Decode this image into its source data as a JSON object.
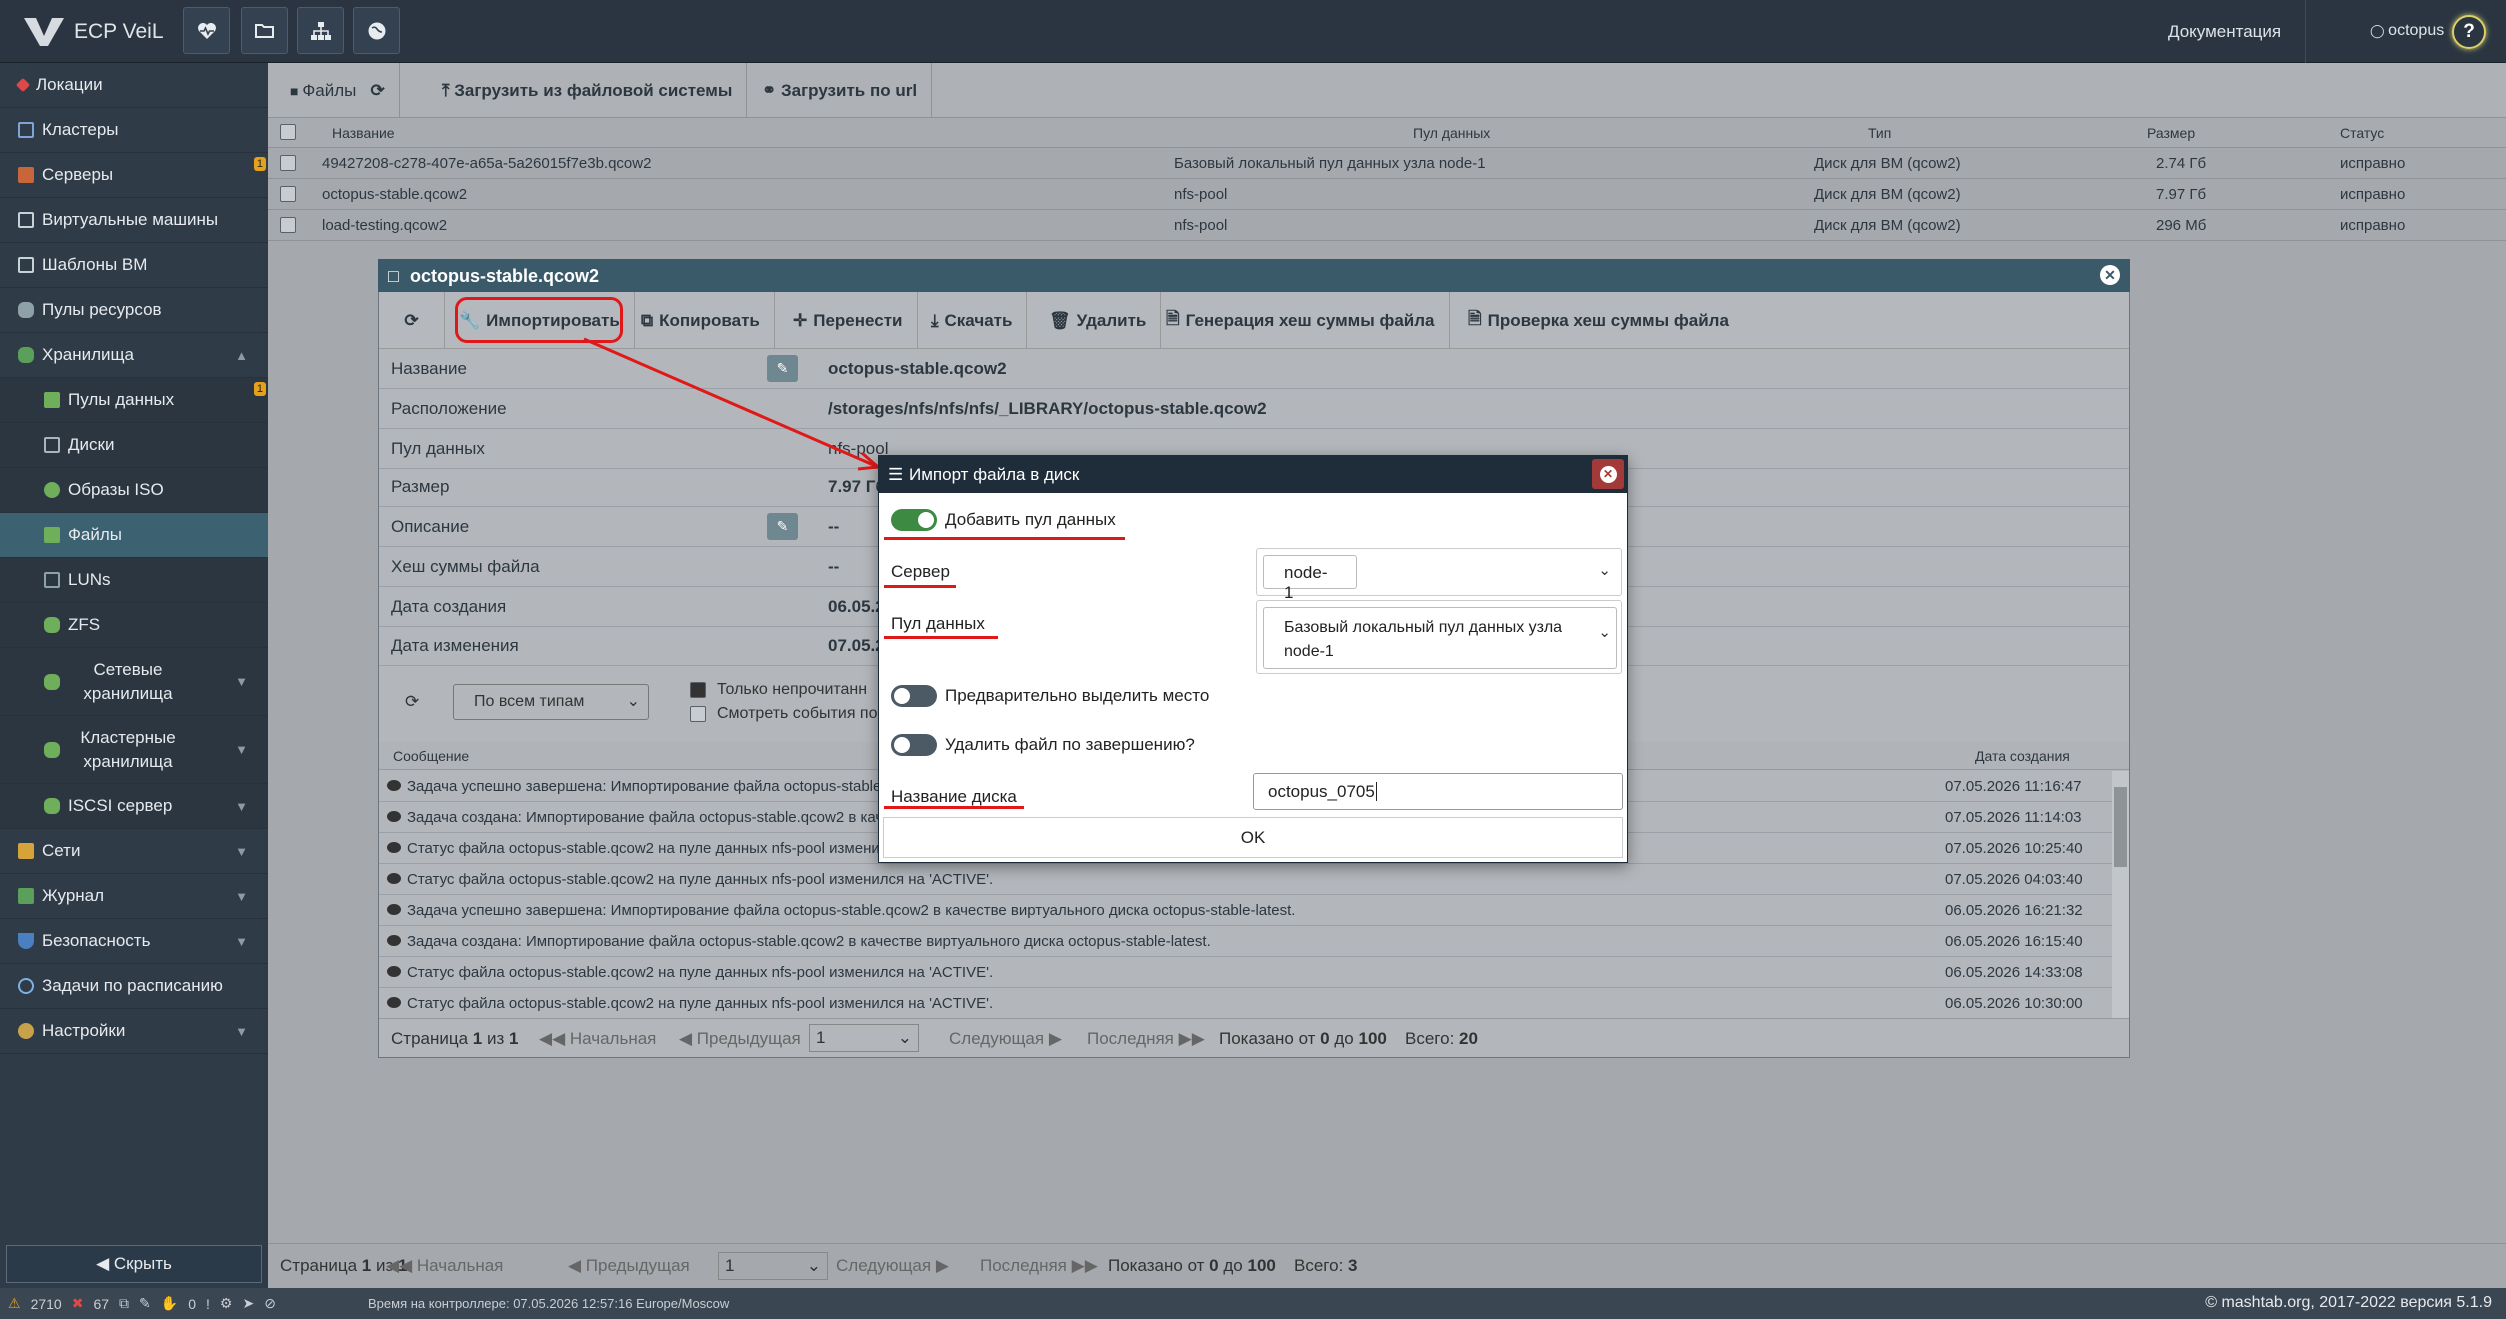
{
  "app": {
    "title": "ECP VeiL",
    "doc_link": "Документация",
    "user": "octopus",
    "help": "?"
  },
  "sidebar": {
    "items": [
      {
        "label": "Локации"
      },
      {
        "label": "Кластеры"
      },
      {
        "label": "Серверы",
        "badge": "1"
      },
      {
        "label": "Виртуальные машины"
      },
      {
        "label": "Шаблоны ВМ"
      },
      {
        "label": "Пулы ресурсов"
      },
      {
        "label": "Хранилища"
      },
      {
        "label": "Пулы данных",
        "badge": "1"
      },
      {
        "label": "Диски"
      },
      {
        "label": "Образы ISO"
      },
      {
        "label": "Файлы"
      },
      {
        "label": "LUNs"
      },
      {
        "label": "ZFS"
      },
      {
        "label": "Сетевые хранилища"
      },
      {
        "label": "Кластерные хранилища"
      },
      {
        "label": "ISCSI сервер"
      },
      {
        "label": "Сети"
      },
      {
        "label": "Журнал"
      },
      {
        "label": "Безопасность"
      },
      {
        "label": "Задачи по расписанию"
      },
      {
        "label": "Настройки"
      }
    ],
    "hide_label": "Скрыть"
  },
  "toolbar": {
    "files": "Файлы",
    "upload_fs": "Загрузить из файловой системы",
    "upload_url": "Загрузить по url"
  },
  "table": {
    "columns": [
      "Название",
      "Пул данных",
      "Тип",
      "Размер",
      "Статус"
    ],
    "rows": [
      {
        "name": "49427208-c278-407e-a65a-5a26015f7e3b.qcow2",
        "pool": "Базовый локальный пул данных узла node-1",
        "type": "Диск для ВМ (qcow2)",
        "size": "2.74 Гб",
        "status": "исправно"
      },
      {
        "name": "octopus-stable.qcow2",
        "pool": "nfs-pool",
        "type": "Диск для ВМ (qcow2)",
        "size": "7.97 Гб",
        "status": "исправно"
      },
      {
        "name": "load-testing.qcow2",
        "pool": "nfs-pool",
        "type": "Диск для ВМ (qcow2)",
        "size": "296 Мб",
        "status": "исправно"
      }
    ]
  },
  "footer": {
    "page": "Страница",
    "page_num": "1",
    "of": "из",
    "total_pages": "1",
    "first": "Начальная",
    "prev": "Предыдущая",
    "page_select": "1",
    "next": "Следующая",
    "last": "Последняя",
    "shown": "Показано от",
    "from": "0",
    "to_word": "до",
    "to": "100",
    "total_label": "Всего:",
    "total": "3"
  },
  "window": {
    "title": "octopus-stable.qcow2",
    "id_tag": "id",
    "actions": {
      "import": "Импортировать",
      "copy": "Копировать",
      "move": "Перенести",
      "download": "Скачать",
      "delete": "Удалить",
      "gen_hash": "Генерация хеш суммы файла",
      "check_hash": "Проверка хеш суммы файла"
    },
    "props": [
      {
        "key": "Название",
        "value": "octopus-stable.qcow2"
      },
      {
        "key": "Расположение",
        "value": "/storages/nfs/nfs/nfs/_LIBRARY/octopus-stable.qcow2"
      },
      {
        "key": "Пул данных",
        "value": "nfs-pool"
      },
      {
        "key": "Размер",
        "value": "7.97 Гб"
      },
      {
        "key": "Описание",
        "value": "--"
      },
      {
        "key": "Хеш суммы файла",
        "value": "--"
      },
      {
        "key": "Дата создания",
        "value": "06.05.2"
      },
      {
        "key": "Дата изменения",
        "value": "07.05.2"
      }
    ],
    "filter": {
      "type_select": "По всем типам",
      "unread_only": "Только непрочитанн",
      "view_events": "Смотреть события по"
    },
    "events_header": {
      "message": "Сообщение",
      "date": "Дата создания"
    },
    "events": [
      {
        "msg": "Задача успешно завершена: Импортирование файла octopus-stable",
        "date": "07.05.2026 11:16:47"
      },
      {
        "msg": "Задача создана: Импортирование файла octopus-stable.qcow2 в кач",
        "date": "07.05.2026 11:14:03"
      },
      {
        "msg": "Статус файла octopus-stable.qcow2 на пуле данных nfs-pool изменил",
        "date": "07.05.2026 10:25:40"
      },
      {
        "msg": "Статус файла octopus-stable.qcow2 на пуле данных nfs-pool изменился на 'ACTIVE'.",
        "date": "07.05.2026 04:03:40"
      },
      {
        "msg": "Задача успешно завершена: Импортирование файла octopus-stable.qcow2 в качестве виртуального диска octopus-stable-latest.",
        "date": "06.05.2026 16:21:32"
      },
      {
        "msg": "Задача создана: Импортирование файла octopus-stable.qcow2 в качестве виртуального диска octopus-stable-latest.",
        "date": "06.05.2026 16:15:40"
      },
      {
        "msg": "Статус файла octopus-stable.qcow2 на пуле данных nfs-pool изменился на 'ACTIVE'.",
        "date": "06.05.2026 14:33:08"
      },
      {
        "msg": "Статус файла octopus-stable.qcow2 на пуле данных nfs-pool изменился на 'ACTIVE'.",
        "date": "06.05.2026 10:30:00"
      }
    ],
    "footer": {
      "page": "Страница",
      "page_num": "1",
      "of": "из",
      "total_pages": "1",
      "first": "Начальная",
      "prev": "Предыдущая",
      "page_select": "1",
      "next": "Следующая",
      "last": "Последняя",
      "shown": "Показано от",
      "from": "0",
      "to_word": "до",
      "to": "100",
      "total_label": "Всего:",
      "total": "20"
    }
  },
  "modal": {
    "title": "Импорт файла в диск",
    "add_pool": "Добавить пул данных",
    "server_label": "Сервер",
    "server_value": "node-1",
    "pool_label": "Пул данных",
    "pool_value": "Базовый локальный пул данных узла node-1",
    "preallocate": "Предварительно выделить место",
    "delete_after": "Удалить файл по завершению?",
    "disk_name_label": "Название диска",
    "disk_name_value": "octopus_0705",
    "ok": "OK",
    "toggles": {
      "add_pool": true,
      "preallocate": false,
      "delete_after": false
    }
  },
  "statusbar": {
    "warn_count": "2710",
    "err_count": "67",
    "c3": "0",
    "time": "Время на контроллере: 07.05.2026 12:57:16 Europe/Moscow",
    "copyright": "© mashtab.org, 2017-2022 версия 5.1.9"
  },
  "colors": {
    "header": "#2a3541",
    "sidebar": "#2f3b47",
    "accent_active": "#3c6170",
    "modal_header": "#1f2d3b",
    "annotation_red": "#e01818",
    "toggle_on": "#3d8a43"
  }
}
